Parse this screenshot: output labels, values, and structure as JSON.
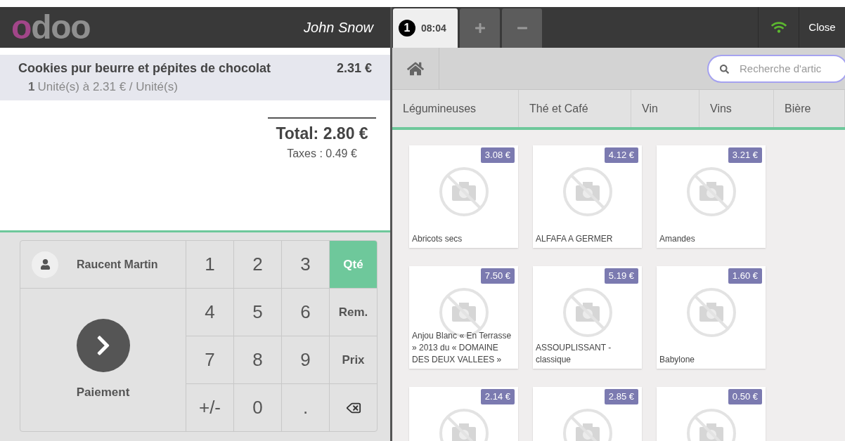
{
  "header": {
    "logo": "odoo",
    "user": "John Snow"
  },
  "order_tabs": [
    {
      "number": "1",
      "time": "08:04",
      "selected": true
    }
  ],
  "tab_actions": [
    {
      "kind": "add"
    },
    {
      "kind": "remove"
    }
  ],
  "connection": {
    "online": true
  },
  "close_label": "Close",
  "order": {
    "lines": [
      {
        "name": "Cookies pur beurre et pépites de chocolat",
        "price": "2.31 €",
        "quantity": "1",
        "detail": "Unité(s) à 2.31 € / Unité(s)",
        "selected": true
      }
    ],
    "total": "Total: 2.80 €",
    "taxes": "Taxes : 0.49 €"
  },
  "customer": "Raucent Martin",
  "payment_label": "Paiement",
  "numpad": [
    {
      "kind": "digit",
      "label": "1"
    },
    {
      "kind": "digit",
      "label": "2"
    },
    {
      "kind": "digit",
      "label": "3"
    },
    {
      "kind": "mode",
      "label": "Qté",
      "selected": true
    },
    {
      "kind": "digit",
      "label": "4"
    },
    {
      "kind": "digit",
      "label": "5"
    },
    {
      "kind": "digit",
      "label": "6"
    },
    {
      "kind": "mode",
      "label": "Rem.",
      "selected": false
    },
    {
      "kind": "digit",
      "label": "7"
    },
    {
      "kind": "digit",
      "label": "8"
    },
    {
      "kind": "digit",
      "label": "9"
    },
    {
      "kind": "mode",
      "label": "Prix",
      "selected": false
    },
    {
      "kind": "digit",
      "label": "+/-"
    },
    {
      "kind": "digit",
      "label": "0"
    },
    {
      "kind": "digit",
      "label": "."
    },
    {
      "kind": "backspace"
    }
  ],
  "search": {
    "placeholder": "Recherche d'artic"
  },
  "categories": [
    "Légumineuses",
    "Thé et Café",
    "Vin",
    "Vins",
    "Bière"
  ],
  "products": [
    {
      "name": "Abricots secs",
      "price": "3.08 €"
    },
    {
      "name": "ALFAFA A GERMER",
      "price": "4.12 €"
    },
    {
      "name": "Amandes",
      "price": "3.21 €"
    },
    {
      "name": "Anjou Blanc « En Terrasse » 2013 du « DOMAINE DES DEUX VALLEES »",
      "price": "7.50 €"
    },
    {
      "name": "ASSOUPLISSANT - classique",
      "price": "5.19 €"
    },
    {
      "name": "Babylone",
      "price": "1.60 €"
    },
    {
      "price": "2.14 €"
    },
    {
      "price": "2.85 €"
    },
    {
      "price": "0.50 €"
    }
  ]
}
